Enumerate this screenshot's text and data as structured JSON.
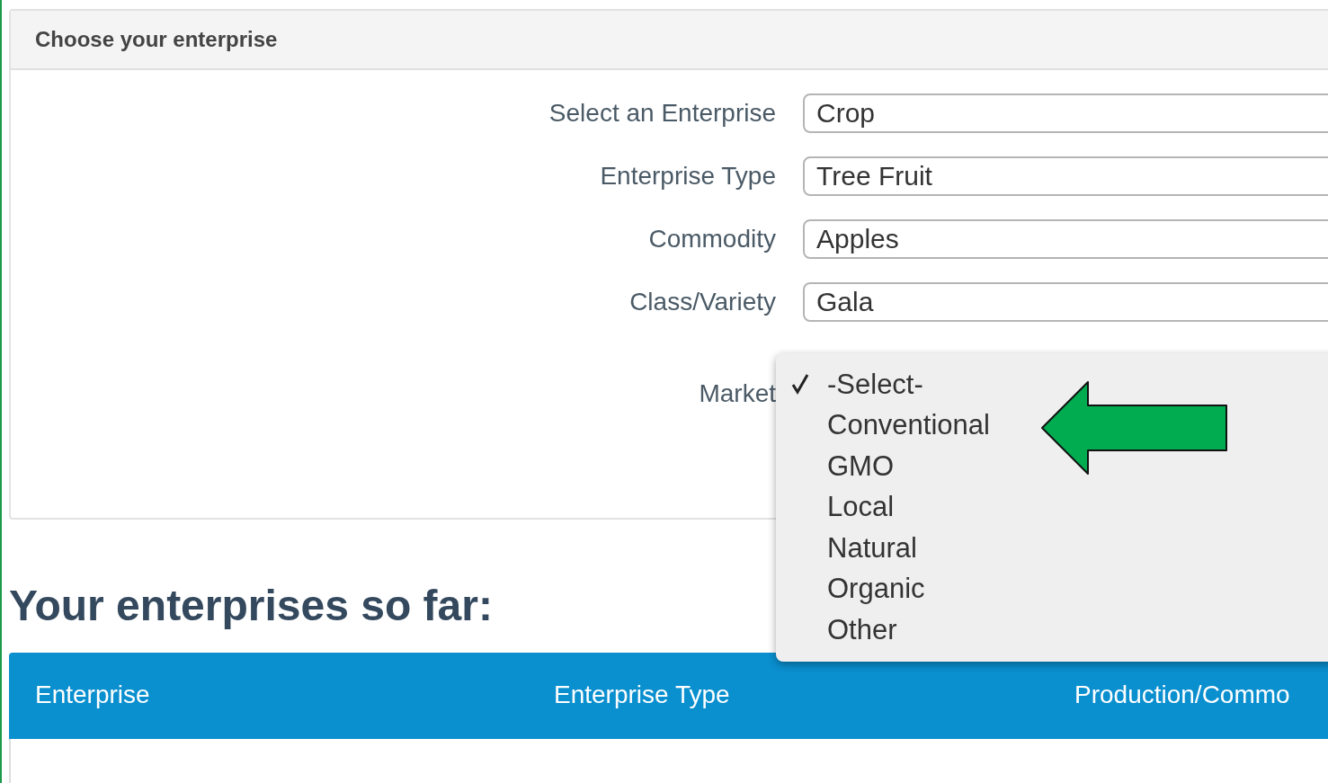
{
  "panel": {
    "title": "Choose your enterprise",
    "fields": [
      {
        "label": "Select an Enterprise",
        "value": "Crop"
      },
      {
        "label": "Enterprise Type",
        "value": "Tree Fruit"
      },
      {
        "label": "Commodity",
        "value": "Apples"
      },
      {
        "label": "Class/Variety",
        "value": "Gala"
      }
    ],
    "market": {
      "label": "Market",
      "options": [
        {
          "label": "-Select-",
          "selected": true
        },
        {
          "label": "Conventional",
          "selected": false
        },
        {
          "label": "GMO",
          "selected": false
        },
        {
          "label": "Local",
          "selected": false
        },
        {
          "label": "Natural",
          "selected": false
        },
        {
          "label": "Organic",
          "selected": false
        },
        {
          "label": "Other",
          "selected": false
        }
      ]
    }
  },
  "heading": "Your enterprises so far:",
  "table": {
    "columns": [
      "Enterprise",
      "Enterprise Type",
      "Production/Commo"
    ]
  }
}
